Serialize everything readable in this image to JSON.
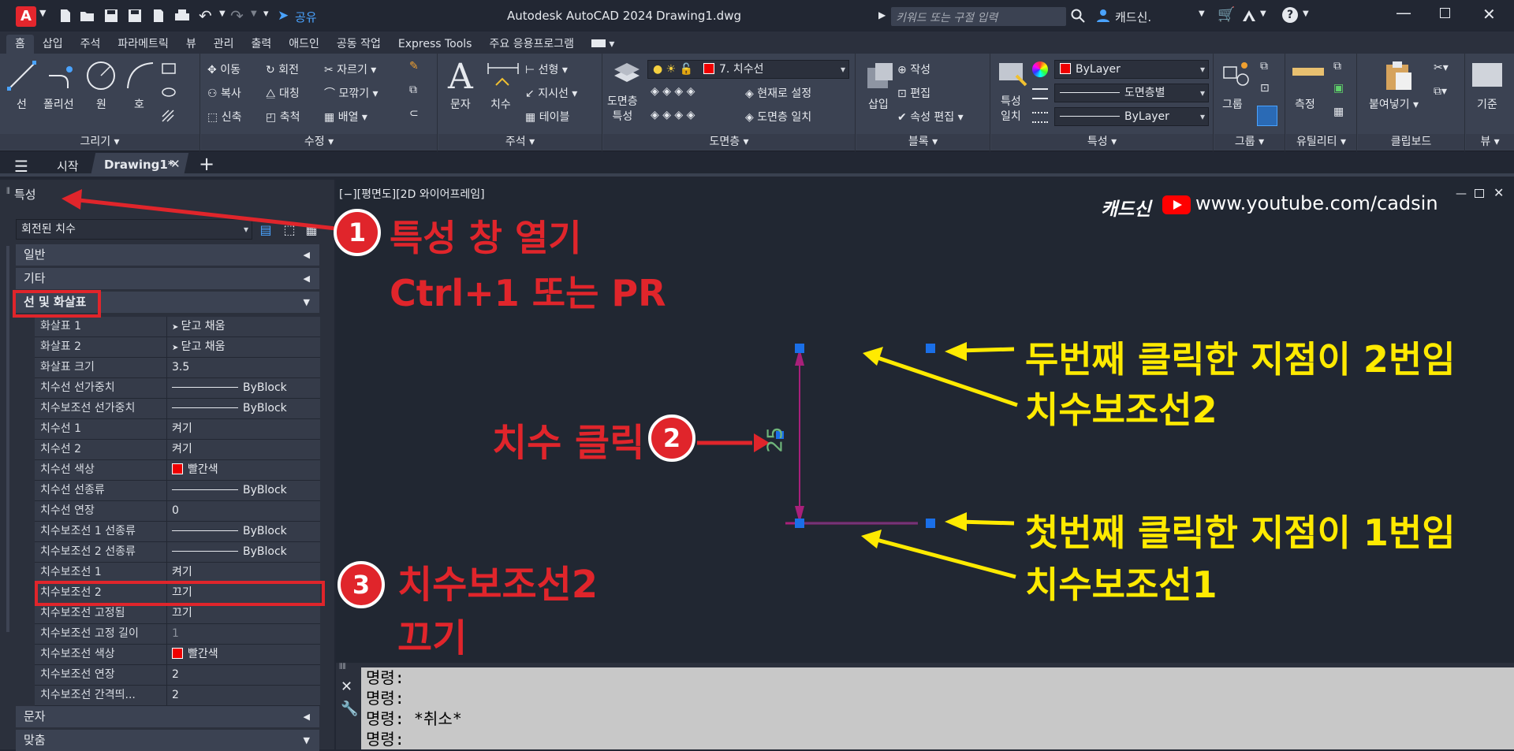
{
  "title": {
    "app": "Autodesk AutoCAD 2024",
    "file": "Drawing1.dwg",
    "logo": "A",
    "share": "공유",
    "search_placeholder": "키워드 또는 구절 입력",
    "user": "캐드신."
  },
  "ribbon_tabs": [
    "홈",
    "삽입",
    "주석",
    "파라메트릭",
    "뷰",
    "관리",
    "출력",
    "애드인",
    "공동 작업",
    "Express Tools",
    "주요 응용프로그램"
  ],
  "ribbon": {
    "draw": {
      "title": "그리기",
      "line": "선",
      "polyline": "폴리선",
      "circle": "원",
      "arc": "호"
    },
    "modify": {
      "title": "수정",
      "move": "이동",
      "rotate": "회전",
      "trim": "자르기",
      "copy": "복사",
      "mirror": "대칭",
      "fillet": "모깎기",
      "stretch": "신축",
      "scale": "축척",
      "array": "배열"
    },
    "annotation": {
      "title": "주석",
      "text": "문자",
      "dimension": "치수",
      "linear": "선형",
      "leader": "지시선",
      "table": "테이블"
    },
    "layers": {
      "title": "도면층",
      "props": "도면층\n특성",
      "current_layer": "7. 치수선",
      "make_current": "현재로 설정",
      "match_layer": "도면층 일치"
    },
    "block": {
      "title": "블록",
      "insert": "삽입",
      "create": "작성",
      "edit": "편집",
      "attr_edit": "속성 편집"
    },
    "properties": {
      "title": "특성",
      "match": "특성\n일치",
      "color": "ByLayer",
      "linetype": "도면층별",
      "lineweight": "ByLayer"
    },
    "groups": {
      "title": "그룹",
      "group": "그룹"
    },
    "utilities": {
      "title": "유틸리티",
      "measure": "측정"
    },
    "clipboard": {
      "title": "클립보드",
      "paste": "붙여넣기"
    },
    "view": {
      "title": "뷰",
      "base": "기준"
    }
  },
  "doc_tabs": {
    "start": "시작",
    "drawing": "Drawing1*"
  },
  "props_panel": {
    "title": "특성",
    "selector": "회전된 치수",
    "sections": {
      "general": "일반",
      "misc": "기타",
      "lines_arrows": "선 및 화살표",
      "text": "문자",
      "fit": "맞춤"
    },
    "rows": [
      {
        "k": "화살표 1",
        "v": "닫고 채움"
      },
      {
        "k": "화살표 2",
        "v": "닫고 채움"
      },
      {
        "k": "화살표 크기",
        "v": "3.5"
      },
      {
        "k": "치수선 선가중치",
        "v": "ByBlock"
      },
      {
        "k": "치수보조선 선가중치",
        "v": "ByBlock"
      },
      {
        "k": "치수선 1",
        "v": "켜기"
      },
      {
        "k": "치수선 2",
        "v": "켜기"
      },
      {
        "k": "치수선 색상",
        "v": "빨간색"
      },
      {
        "k": "치수선 선종류",
        "v": "ByBlock"
      },
      {
        "k": "치수선 연장",
        "v": "0"
      },
      {
        "k": "치수보조선 1 선종류",
        "v": "ByBlock"
      },
      {
        "k": "치수보조선 2 선종류",
        "v": "ByBlock"
      },
      {
        "k": "치수보조선 1",
        "v": "켜기"
      },
      {
        "k": "치수보조선 2",
        "v": "끄기"
      },
      {
        "k": "치수보조선 고정됨",
        "v": "끄기"
      },
      {
        "k": "치수보조선 고정 길이",
        "v": "1"
      },
      {
        "k": "치수보조선 색상",
        "v": "빨간색"
      },
      {
        "k": "치수보조선 연장",
        "v": "2"
      },
      {
        "k": "치수보조선 간격띄...",
        "v": "2"
      }
    ]
  },
  "viewport": {
    "label": "[−][평면도][2D 와이어프레임]",
    "brand": "캐드신",
    "url": "www.youtube.com/cadsin",
    "dim_text": "25"
  },
  "annotations": {
    "a1_num": "1",
    "a1_line1": "특성 창 열기",
    "a1_line2": "Ctrl+1 또는 PR",
    "a2_num": "2",
    "a2_text": "치수 클릭",
    "a3_num": "3",
    "a3_line1": "치수보조선2",
    "a3_line2": "끄기",
    "y1": "두번째 클릭한 지점이 2번임",
    "y2": "치수보조선2",
    "y3": "첫번째 클릭한 지점이 1번임",
    "y4": "치수보조선1"
  },
  "command": {
    "lines": [
      "명령:",
      "명령:",
      "명령: *취소*",
      "명령:"
    ]
  },
  "colors": {
    "accent_red": "#e0252b",
    "annotation_yellow": "#ffea00",
    "dim_line": "#a8207a",
    "grip_blue": "#1a6fe8"
  }
}
